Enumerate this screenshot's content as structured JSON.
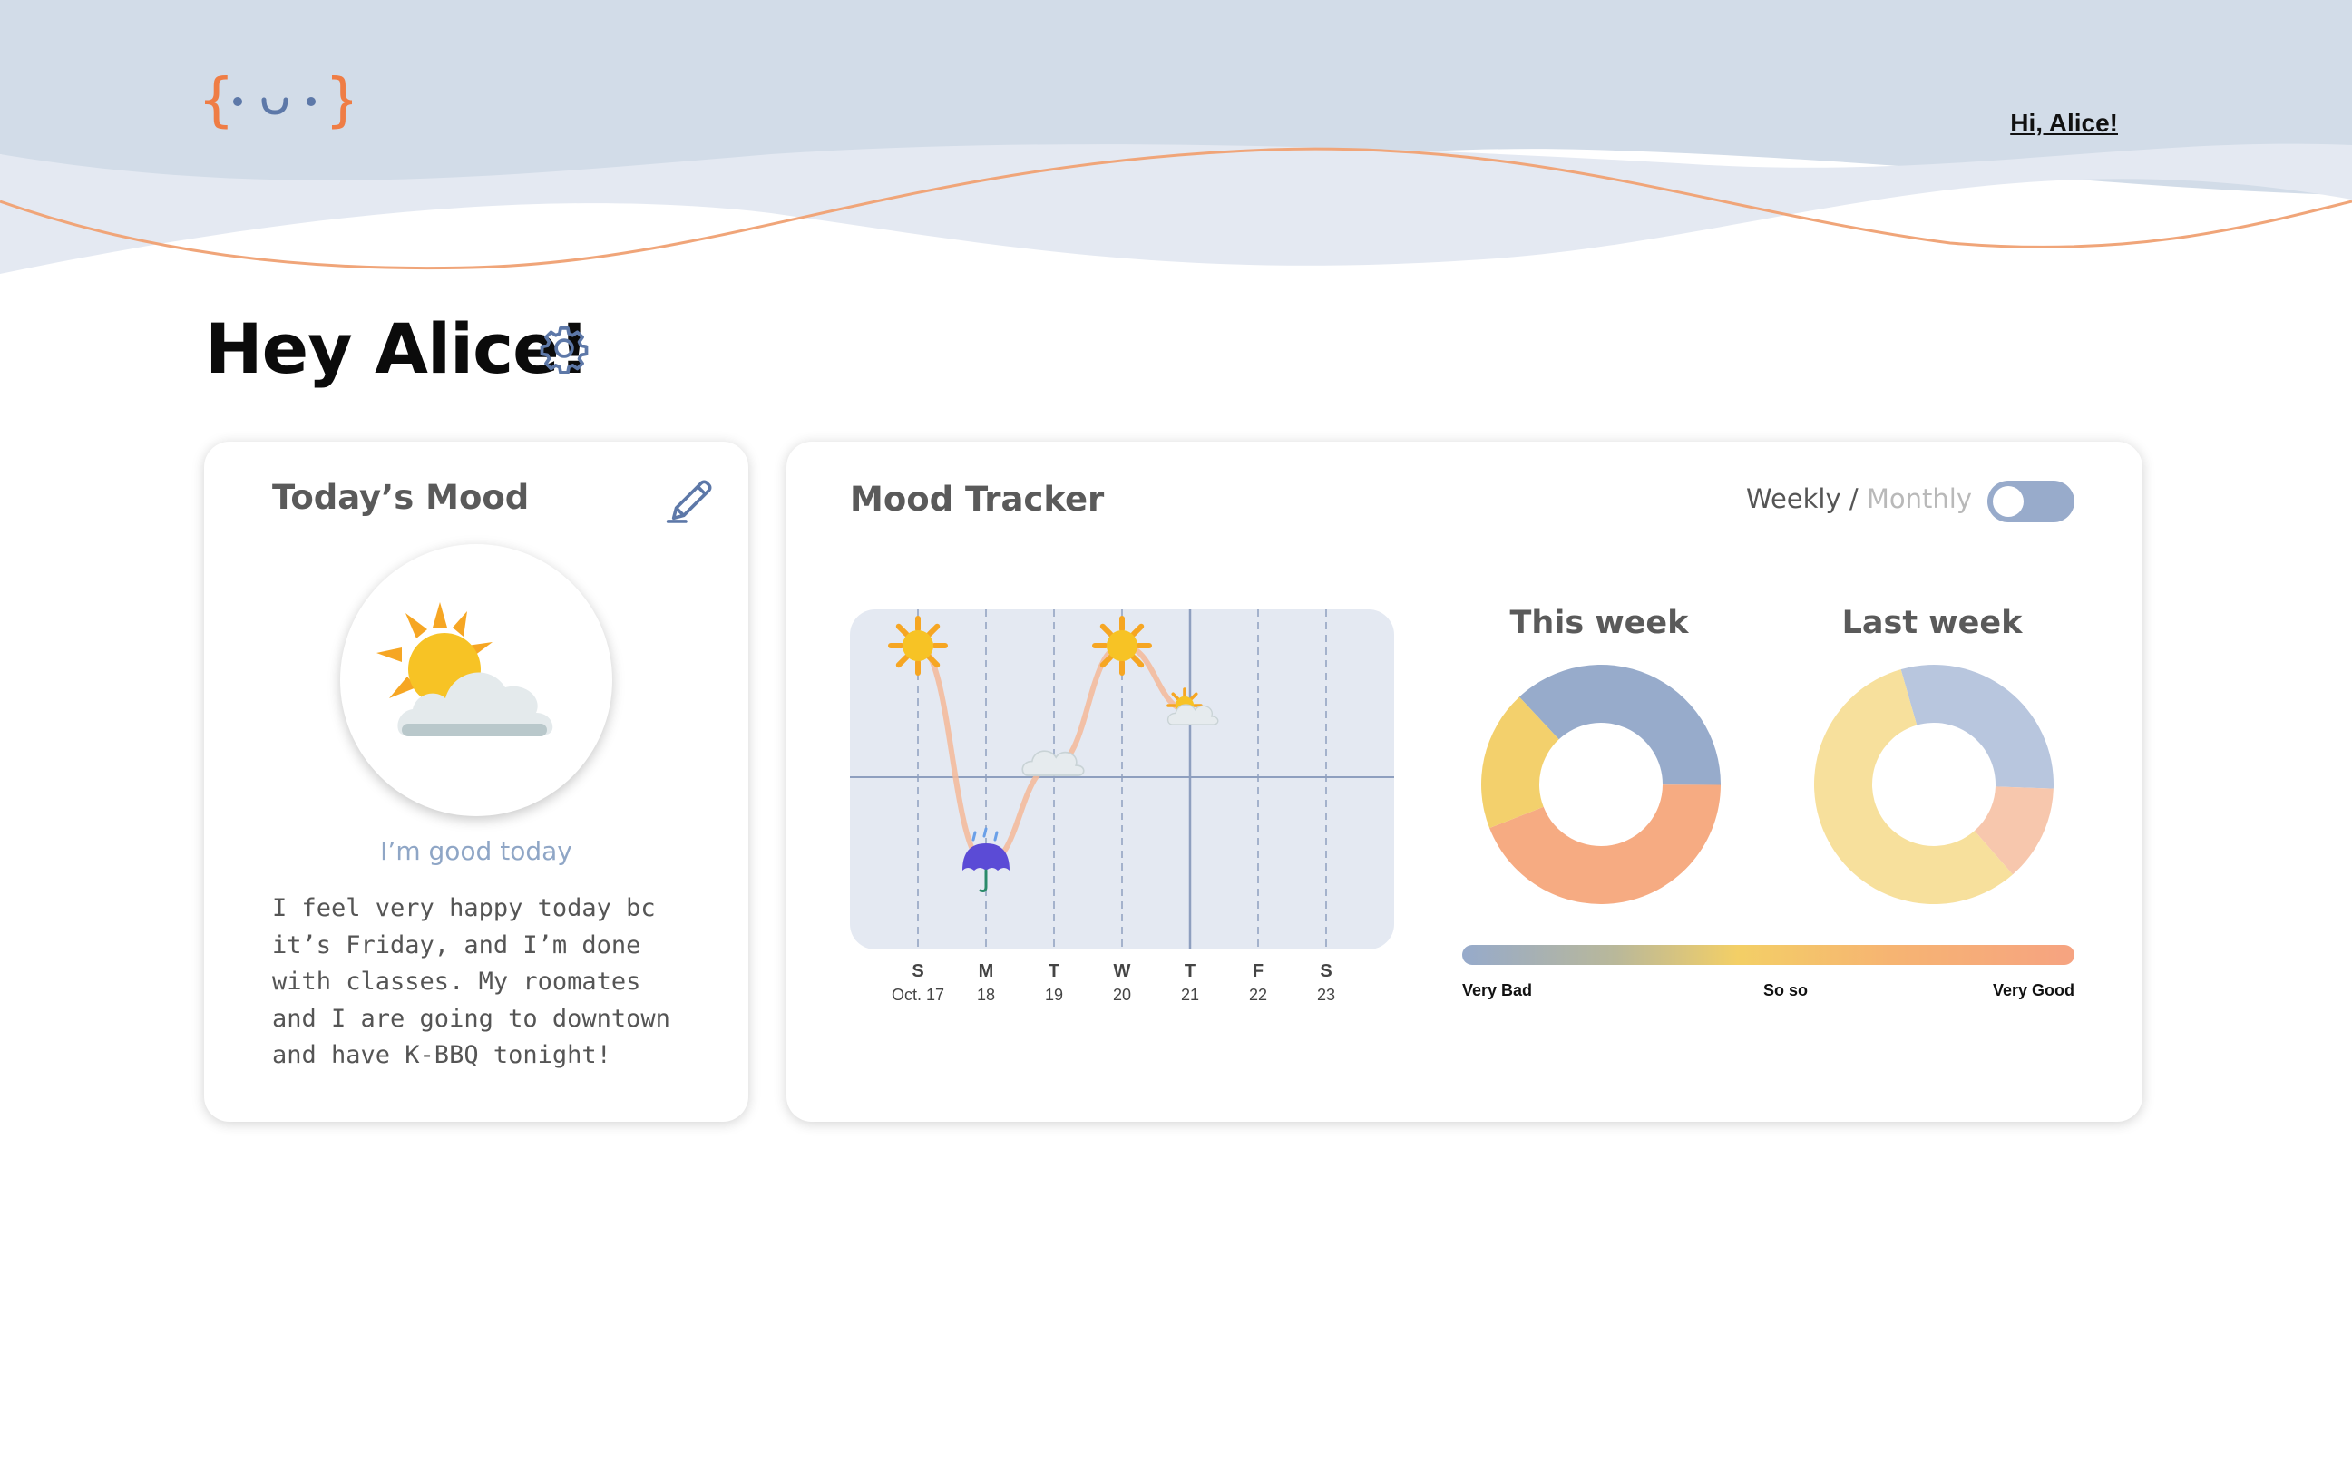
{
  "header": {
    "greeting_link": "Hi, Alice!",
    "colors": {
      "wave_back": "#d2dce8",
      "wave_front": "#e4e9f2",
      "wave_line": "#f0a579",
      "logo_brace": "#ef7d45",
      "logo_face": "#5d78a8"
    }
  },
  "page": {
    "title": "Hey Alice!",
    "settings_icon": "gear-icon"
  },
  "mood_card": {
    "title": "Today’s Mood",
    "edit_icon": "pencil-icon",
    "weather_icon": "sun-behind-cloud-icon",
    "status": "I’m good today",
    "note": "I feel very happy today bc\nit’s Friday, and I’m done\nwith classes. My roomates\nand I are going to downtown\nand have K-BBQ tonight!"
  },
  "tracker_card": {
    "title": "Mood Tracker",
    "toggle": {
      "option_active": "Weekly",
      "separator": " / ",
      "option_inactive": "Monthly",
      "state": "weekly"
    },
    "this_week_title": "This week",
    "last_week_title": "Last week",
    "scale": {
      "low": "Very Bad",
      "mid": "So so",
      "high": "Very Good"
    }
  },
  "chart_data": [
    {
      "type": "line",
      "x_day_letters": [
        "S",
        "M",
        "T",
        "W",
        "T",
        "F",
        "S"
      ],
      "x_dates": [
        "Oct. 17",
        "18",
        "19",
        "20",
        "21",
        "22",
        "23"
      ],
      "points": [
        {
          "day": "S",
          "mood": 4,
          "icon": "sun-icon"
        },
        {
          "day": "M",
          "mood": 0,
          "icon": "umbrella-rain-icon"
        },
        {
          "day": "T",
          "mood": 1.8,
          "icon": "cloud-icon"
        },
        {
          "day": "W",
          "mood": 4,
          "icon": "sun-icon"
        },
        {
          "day": "T",
          "mood": 2.8,
          "icon": "sun-behind-cloud-icon"
        }
      ],
      "ylim": [
        0,
        4
      ],
      "current_day_index": 4,
      "colors": {
        "line": "#f5b899",
        "background": "#e4e9f2",
        "grid": "#8e9fbf"
      }
    },
    {
      "type": "pie",
      "name": "This week",
      "slices": [
        {
          "mood": "bad",
          "value": 37,
          "color": "#97abcb"
        },
        {
          "mood": "good",
          "value": 44,
          "color": "#f6ab82"
        },
        {
          "mood": "so so",
          "value": 19,
          "color": "#f3d06c"
        }
      ]
    },
    {
      "type": "pie",
      "name": "Last week",
      "slices": [
        {
          "mood": "bad",
          "value": 30,
          "color": "#b8c6de"
        },
        {
          "mood": "good",
          "value": 13,
          "color": "#f7c7ad"
        },
        {
          "mood": "so so",
          "value": 57,
          "color": "#f7e09c"
        }
      ]
    }
  ]
}
